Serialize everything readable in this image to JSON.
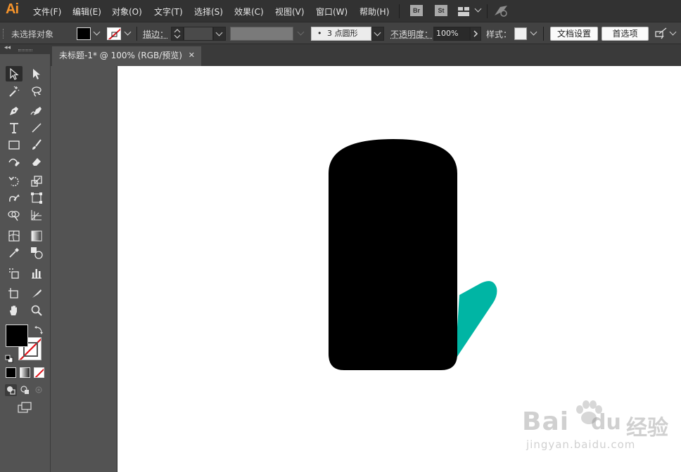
{
  "app": {
    "logo": "Ai"
  },
  "menubar": {
    "items": [
      "文件(F)",
      "编辑(E)",
      "对象(O)",
      "文字(T)",
      "选择(S)",
      "效果(C)",
      "视图(V)",
      "窗口(W)",
      "帮助(H)"
    ],
    "bridge_label": "Br",
    "stock_label": "St"
  },
  "control": {
    "selection_status": "未选择对象",
    "stroke_label": "描边：",
    "brush_point": "•",
    "brush_label": "3 点圆形",
    "opacity_label": "不透明度：",
    "opacity_value": "100%",
    "style_label": "样式：",
    "doc_setup_button": "文档设置",
    "prefs_button": "首选项"
  },
  "document": {
    "tab_title": "未标题-1* @ 100% (RGB/预览)",
    "close_glyph": "✕"
  },
  "colors": {
    "fill": "#000000",
    "stroke": "none",
    "shape_black": "#000000",
    "shape_teal": "#00b5a4",
    "artboard": "#ffffff"
  },
  "watermark": {
    "brand": "Bai",
    "brand_suffix": "du",
    "brand_cn": "经验",
    "url": "jingyan.baidu.com"
  }
}
